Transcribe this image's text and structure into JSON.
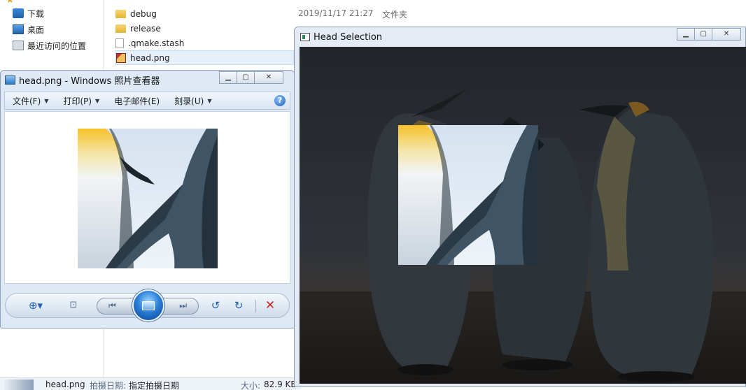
{
  "explorer": {
    "nav_items": [
      {
        "label": "下载",
        "icon": "download-folder-icon"
      },
      {
        "label": "桌面",
        "icon": "desktop-icon"
      },
      {
        "label": "最近访问的位置",
        "icon": "recent-places-icon"
      }
    ],
    "files": [
      {
        "name": "debug",
        "date": "2019/11/17 21:27",
        "type": "文件夹",
        "icon": "folder-icon"
      },
      {
        "name": "release",
        "date": "",
        "type": "",
        "icon": "folder-icon"
      },
      {
        "name": ".qmake.stash",
        "date": "",
        "type": "",
        "icon": "file-icon"
      },
      {
        "name": "head.png",
        "date": "",
        "type": "",
        "icon": "png-file-icon"
      }
    ],
    "details": {
      "name": "head.png",
      "taken_label": "拍摄日期:",
      "taken_value": "指定拍摄日期",
      "size_label": "大小:",
      "size_value": "82.9 KB"
    }
  },
  "viewer": {
    "title": "head.png - Windows 照片查看器",
    "menus": [
      {
        "label": "文件(F)"
      },
      {
        "label": "打印(P)"
      },
      {
        "label": "电子邮件(E)"
      },
      {
        "label": "刻录(U)"
      }
    ],
    "help_label": "?",
    "caption": {
      "minimize": "▁",
      "maximize": "▢",
      "close": "✕"
    }
  },
  "headsel": {
    "title": "Head Selection",
    "caption": {
      "minimize": "▁",
      "maximize": "▢",
      "close": "✕"
    }
  },
  "colors": {
    "accent": "#2b7fd8",
    "title_bar": "#dfe9f5",
    "scene_dark": "#23272c"
  }
}
